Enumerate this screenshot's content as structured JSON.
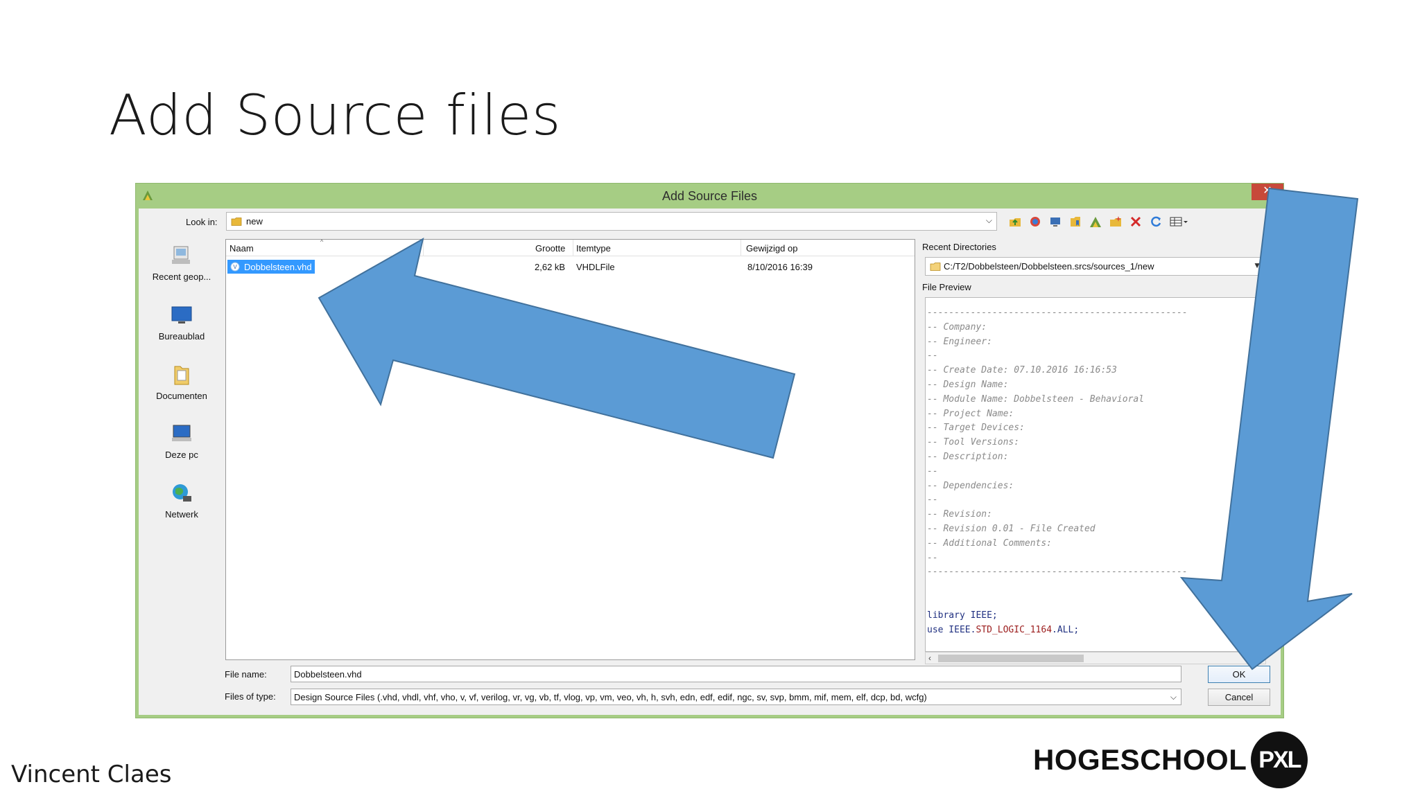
{
  "slide": {
    "title": "Add Source files",
    "author": "Vincent Claes",
    "logo_text": "HOGESCHOOL",
    "logo_badge": "PXL"
  },
  "dialog": {
    "title": "Add Source Files",
    "close": "✕",
    "look_in_label": "Look in:",
    "look_in_value": "new",
    "toolbar_icons": [
      "up-folder-icon",
      "web-icon",
      "desktop-icon",
      "bookmark-icon",
      "vivado-icon",
      "new-folder-icon",
      "delete-icon",
      "refresh-icon",
      "view-menu-icon"
    ],
    "places": [
      {
        "label": "Recent geop...",
        "icon": "recent-places-icon"
      },
      {
        "label": "Bureaublad",
        "icon": "desktop-icon"
      },
      {
        "label": "Documenten",
        "icon": "documents-icon"
      },
      {
        "label": "Deze pc",
        "icon": "this-pc-icon"
      },
      {
        "label": "Netwerk",
        "icon": "network-icon"
      }
    ],
    "columns": {
      "name": "Naam",
      "size": "Grootte",
      "type": "Itemtype",
      "modified": "Gewijzigd op"
    },
    "files": [
      {
        "name": "Dobbelsteen.vhd",
        "size": "2,62 kB",
        "type": "VHDLFile",
        "modified": "8/10/2016 16:39"
      }
    ],
    "recent_dirs_label": "Recent Directories",
    "recent_dir": "C:/T2/Dobbelsteen/Dobbelsteen.srcs/sources_1/new",
    "preview_label": "File Preview",
    "preview_lines": [
      "------------------------------------------------",
      "-- Company:",
      "-- Engineer:",
      "--",
      "-- Create Date: 07.10.2016 16:16:53",
      "-- Design Name:",
      "-- Module Name: Dobbelsteen - Behavioral",
      "-- Project Name:",
      "-- Target Devices:",
      "-- Tool Versions:",
      "-- Description:",
      "--",
      "-- Dependencies:",
      "--",
      "-- Revision:",
      "-- Revision 0.01 - File Created",
      "-- Additional Comments:",
      "--",
      "------------------------------------------------"
    ],
    "code_line_1": "library IEEE;",
    "code_line_2_prefix": "use IEEE.",
    "code_line_2_hl": "STD_LOGIC_1164",
    "code_line_2_suffix": ".ALL;",
    "file_name_label": "File name:",
    "file_name_value": "Dobbelsteen.vhd",
    "files_of_type_label": "Files of type:",
    "files_of_type_value": "Design Source Files (.vhd, vhdl, vhf, vho, v, vf, verilog, vr, vg, vb, tf, vlog, vp, vm, veo, vh, h, svh, edn, edf, edif, ngc, sv, svp, bmm, mif, mem, elf, dcp, bd, wcfg)",
    "ok_label": "OK",
    "cancel_label": "Cancel"
  },
  "colors": {
    "dialog_frame": "#a6cd84",
    "selection": "#3399ff",
    "arrow_fill": "#5b9bd5",
    "close_button": "#c7493a"
  }
}
